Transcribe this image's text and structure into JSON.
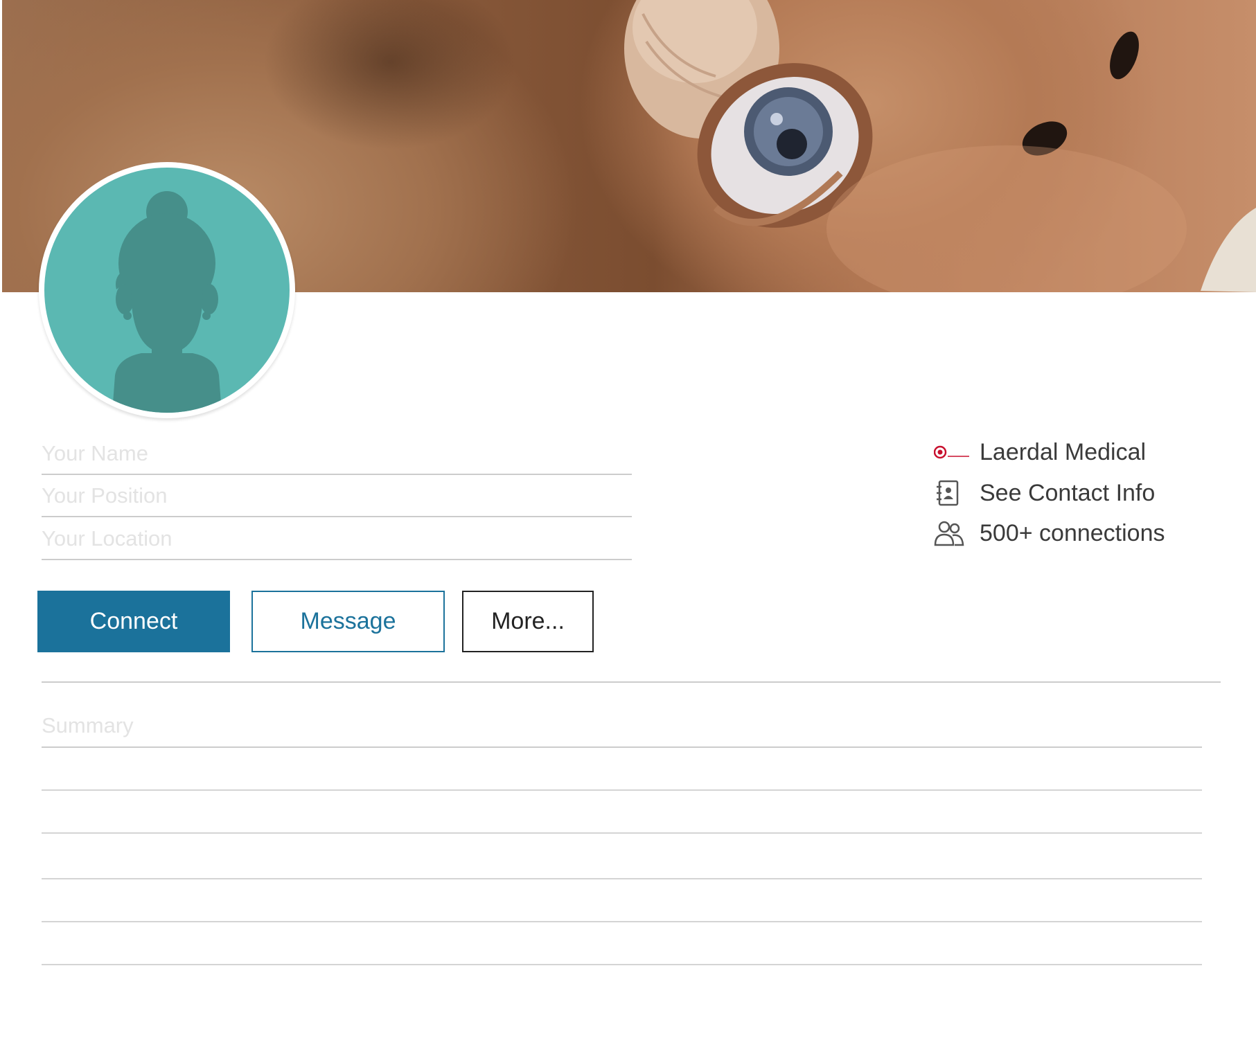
{
  "profile": {
    "name_placeholder": "Your Name",
    "position_placeholder": "Your Position",
    "location_placeholder": "Your Location",
    "summary_placeholder": "Summary"
  },
  "actions": {
    "connect_label": "Connect",
    "message_label": "Message",
    "more_label": "More..."
  },
  "info": {
    "company": "Laerdal Medical",
    "company_logo_text": "Laerdal",
    "contact": "See Contact Info",
    "connections": "500+ connections"
  },
  "colors": {
    "accent": "#1b729b",
    "avatar_bg": "#5bb8b2",
    "avatar_silhouette": "#468f8a"
  },
  "icons": {
    "company": "laerdal-logo-icon",
    "contact": "contact-book-icon",
    "connections": "people-icon"
  }
}
